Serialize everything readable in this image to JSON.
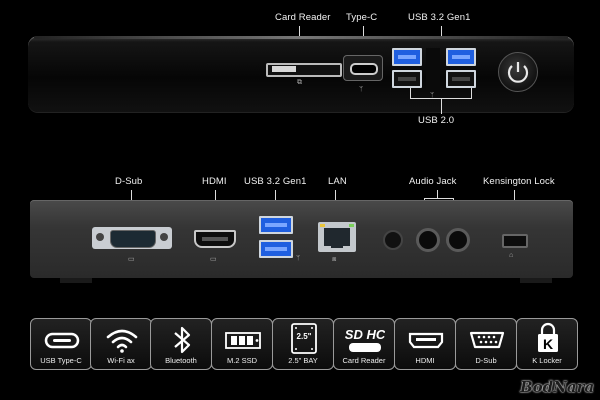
{
  "front_labels": {
    "card_reader": "Card Reader",
    "type_c": "Type-C",
    "usb32_gen1": "USB 3.2 Gen1",
    "usb20": "USB 2.0"
  },
  "rear_labels": {
    "dsub": "D-Sub",
    "hdmi": "HDMI",
    "usb32_gen1": "USB 3.2 Gen1",
    "lan": "LAN",
    "audio_jack": "Audio Jack",
    "kensington": "Kensington Lock"
  },
  "features": [
    {
      "label": "USB Type-C",
      "icon": "usb-type-c-icon"
    },
    {
      "label": "Wi-Fi ax",
      "icon": "wifi-icon"
    },
    {
      "label": "Bluetooth",
      "icon": "bluetooth-icon"
    },
    {
      "label": "M.2 SSD",
      "icon": "m2-ssd-icon"
    },
    {
      "label": "2.5\" BAY",
      "icon": "drive-bay-icon",
      "badge": "2.5\""
    },
    {
      "label": "Card Reader",
      "icon": "sdhc-card-icon",
      "badge": "SD HC"
    },
    {
      "label": "HDMI",
      "icon": "hdmi-icon"
    },
    {
      "label": "D-Sub",
      "icon": "dsub-icon"
    },
    {
      "label": "K Locker",
      "icon": "k-lock-icon",
      "badge": "K"
    }
  ],
  "watermark": "BodNara",
  "colors": {
    "usb3_blue": "#1f5fe0",
    "background": "#000000"
  }
}
